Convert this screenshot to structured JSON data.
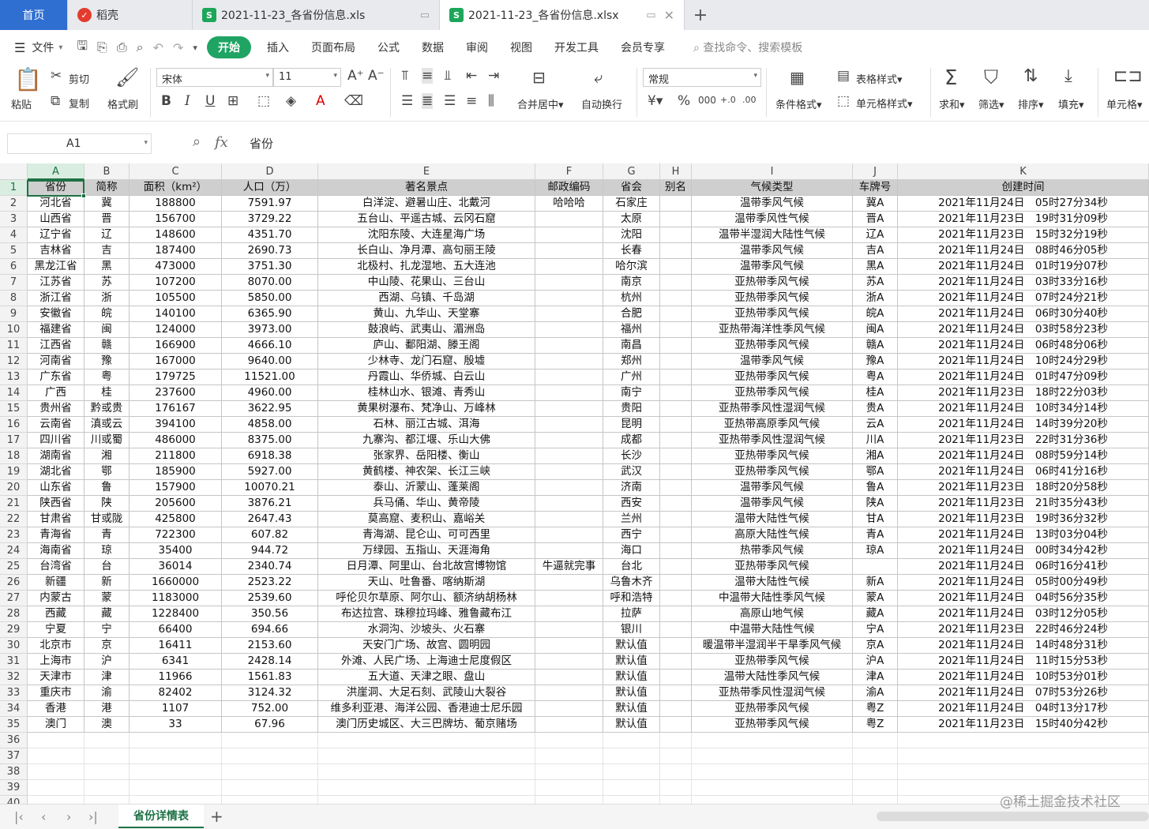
{
  "tabs": {
    "home": "首页",
    "daoke": "稻壳",
    "xls": "2021-11-23_各省份信息.xls",
    "active": "2021-11-23_各省份信息.xlsx",
    "home_color": "#2f6fd1"
  },
  "menu": {
    "file": "文件",
    "items": [
      "开始",
      "插入",
      "页面布局",
      "公式",
      "数据",
      "审阅",
      "视图",
      "开发工具",
      "会员专享"
    ],
    "search": "查找命令、搜索模板",
    "accent": "#1fa463"
  },
  "ribbon": {
    "paste": "粘贴",
    "cut": "剪切",
    "copy": "复制",
    "format_painter": "格式刷",
    "font": "宋体",
    "font_size": "11",
    "merge": "合并居中",
    "wrap": "自动换行",
    "number_format": "常规",
    "cond_format": "条件格式",
    "table_style": "表格样式",
    "cell_style": "单元格样式",
    "sum": "求和",
    "filter": "筛选",
    "sort": "排序",
    "fill": "填充",
    "cell": "单元格"
  },
  "formula_bar": {
    "name_box": "A1",
    "fx": "fx",
    "content": "省份"
  },
  "grid": {
    "columns": [
      "A",
      "B",
      "C",
      "D",
      "E",
      "F",
      "G",
      "H",
      "I",
      "J",
      "K"
    ],
    "header_row": [
      "省份",
      "简称",
      "面积（km²）",
      "人口（万）",
      "著名景点",
      "邮政编码",
      "省会",
      "别名",
      "气候类型",
      "车牌号",
      "创建时间"
    ],
    "rows": [
      [
        "河北省",
        "冀",
        "188800",
        "7591.97",
        "白洋淀、避暑山庄、北戴河",
        "哈哈哈",
        "石家庄",
        "",
        "温带季风气候",
        "冀A",
        "2021年11月24日　05时27分34秒"
      ],
      [
        "山西省",
        "晋",
        "156700",
        "3729.22",
        "五台山、平遥古城、云冈石窟",
        "",
        "太原",
        "",
        "温带季风性气候",
        "晋A",
        "2021年11月23日　19时31分09秒"
      ],
      [
        "辽宁省",
        "辽",
        "148600",
        "4351.70",
        "沈阳东陵、大连星海广场",
        "",
        "沈阳",
        "",
        "温带半湿润大陆性气候",
        "辽A",
        "2021年11月23日　15时32分19秒"
      ],
      [
        "吉林省",
        "吉",
        "187400",
        "2690.73",
        "长白山、净月潭、高句丽王陵",
        "",
        "长春",
        "",
        "温带季风气候",
        "吉A",
        "2021年11月24日　08时46分05秒"
      ],
      [
        "黑龙江省",
        "黑",
        "473000",
        "3751.30",
        "北极村、扎龙湿地、五大连池",
        "",
        "哈尔滨",
        "",
        "温带季风气候",
        "黑A",
        "2021年11月24日　01时19分07秒"
      ],
      [
        "江苏省",
        "苏",
        "107200",
        "8070.00",
        "中山陵、花果山、三台山",
        "",
        "南京",
        "",
        "亚热带季风气候",
        "苏A",
        "2021年11月24日　03时33分16秒"
      ],
      [
        "浙江省",
        "浙",
        "105500",
        "5850.00",
        "西湖、乌镇、千岛湖",
        "",
        "杭州",
        "",
        "亚热带季风气候",
        "浙A",
        "2021年11月24日　07时24分21秒"
      ],
      [
        "安徽省",
        "皖",
        "140100",
        "6365.90",
        "黄山、九华山、天堂寨",
        "",
        "合肥",
        "",
        "亚热带季风气候",
        "皖A",
        "2021年11月24日　06时30分40秒"
      ],
      [
        "福建省",
        "闽",
        "124000",
        "3973.00",
        "鼓浪屿、武夷山、湄洲岛",
        "",
        "福州",
        "",
        "亚热带海洋性季风气候",
        "闽A",
        "2021年11月24日　03时58分23秒"
      ],
      [
        "江西省",
        "赣",
        "166900",
        "4666.10",
        "庐山、鄱阳湖、滕王阁",
        "",
        "南昌",
        "",
        "亚热带季风气候",
        "赣A",
        "2021年11月24日　06时48分06秒"
      ],
      [
        "河南省",
        "豫",
        "167000",
        "9640.00",
        "少林寺、龙门石窟、殷墟",
        "",
        "郑州",
        "",
        "温带季风气候",
        "豫A",
        "2021年11月24日　10时24分29秒"
      ],
      [
        "广东省",
        "粤",
        "179725",
        "11521.00",
        "丹霞山、华侨城、白云山",
        "",
        "广州",
        "",
        "亚热带季风气候",
        "粤A",
        "2021年11月24日　01时47分09秒"
      ],
      [
        "广西",
        "桂",
        "237600",
        "4960.00",
        "桂林山水、银滩、青秀山",
        "",
        "南宁",
        "",
        "亚热带季风气候",
        "桂A",
        "2021年11月23日　18时22分03秒"
      ],
      [
        "贵州省",
        "黔或贵",
        "176167",
        "3622.95",
        "黄果树瀑布、梵净山、万峰林",
        "",
        "贵阳",
        "",
        "亚热带季风性湿润气候",
        "贵A",
        "2021年11月24日　10时34分14秒"
      ],
      [
        "云南省",
        "滇或云",
        "394100",
        "4858.00",
        "石林、丽江古城、洱海",
        "",
        "昆明",
        "",
        "亚热带高原季风气候",
        "云A",
        "2021年11月24日　14时39分20秒"
      ],
      [
        "四川省",
        "川或蜀",
        "486000",
        "8375.00",
        "九寨沟、都江堰、乐山大佛",
        "",
        "成都",
        "",
        "亚热带季风性湿润气候",
        "川A",
        "2021年11月23日　22时31分36秒"
      ],
      [
        "湖南省",
        "湘",
        "211800",
        "6918.38",
        "张家界、岳阳楼、衡山",
        "",
        "长沙",
        "",
        "亚热带季风气候",
        "湘A",
        "2021年11月24日　08时59分14秒"
      ],
      [
        "湖北省",
        "鄂",
        "185900",
        "5927.00",
        "黄鹤楼、神农架、长江三峡",
        "",
        "武汉",
        "",
        "亚热带季风气候",
        "鄂A",
        "2021年11月24日　06时41分16秒"
      ],
      [
        "山东省",
        "鲁",
        "157900",
        "10070.21",
        "泰山、沂蒙山、蓬莱阁",
        "",
        "济南",
        "",
        "温带季风气候",
        "鲁A",
        "2021年11月23日　18时20分58秒"
      ],
      [
        "陕西省",
        "陕",
        "205600",
        "3876.21",
        "兵马俑、华山、黄帝陵",
        "",
        "西安",
        "",
        "温带季风气候",
        "陕A",
        "2021年11月23日　21时35分43秒"
      ],
      [
        "甘肃省",
        "甘或陇",
        "425800",
        "2647.43",
        "莫高窟、麦积山、嘉峪关",
        "",
        "兰州",
        "",
        "温带大陆性气候",
        "甘A",
        "2021年11月23日　19时36分32秒"
      ],
      [
        "青海省",
        "青",
        "722300",
        "607.82",
        "青海湖、昆仑山、可可西里",
        "",
        "西宁",
        "",
        "高原大陆性气候",
        "青A",
        "2021年11月24日　13时03分04秒"
      ],
      [
        "海南省",
        "琼",
        "35400",
        "944.72",
        "万绿园、五指山、天涯海角",
        "",
        "海口",
        "",
        "热带季风气候",
        "琼A",
        "2021年11月24日　00时34分42秒"
      ],
      [
        "台湾省",
        "台",
        "36014",
        "2340.74",
        "日月潭、阿里山、台北故宫博物馆",
        "牛逼就完事",
        "台北",
        "",
        "亚热带季风气候",
        "",
        "2021年11月24日　06时16分41秒"
      ],
      [
        "新疆",
        "新",
        "1660000",
        "2523.22",
        "天山、吐鲁番、喀纳斯湖",
        "",
        "乌鲁木齐",
        "",
        "温带大陆性气候",
        "新A",
        "2021年11月24日　05时00分49秒"
      ],
      [
        "内蒙古",
        "蒙",
        "1183000",
        "2539.60",
        "呼伦贝尔草原、阿尔山、额济纳胡杨林",
        "",
        "呼和浩特",
        "",
        "中温带大陆性季风气候",
        "蒙A",
        "2021年11月24日　04时56分35秒"
      ],
      [
        "西藏",
        "藏",
        "1228400",
        "350.56",
        "布达拉宫、珠穆拉玛峰、雅鲁藏布江",
        "",
        "拉萨",
        "",
        "高原山地气候",
        "藏A",
        "2021年11月24日　03时12分05秒"
      ],
      [
        "宁夏",
        "宁",
        "66400",
        "694.66",
        "水洞沟、沙坡头、火石寨",
        "",
        "银川",
        "",
        "中温带大陆性气候",
        "宁A",
        "2021年11月23日　22时46分24秒"
      ],
      [
        "北京市",
        "京",
        "16411",
        "2153.60",
        "天安门广场、故宫、圆明园",
        "",
        "默认值",
        "",
        "暖温带半湿润半干旱季风气候",
        "京A",
        "2021年11月24日　14时48分31秒"
      ],
      [
        "上海市",
        "沪",
        "6341",
        "2428.14",
        "外滩、人民广场、上海迪士尼度假区",
        "",
        "默认值",
        "",
        "亚热带季风气候",
        "沪A",
        "2021年11月24日　11时15分53秒"
      ],
      [
        "天津市",
        "津",
        "11966",
        "1561.83",
        "五大道、天津之眼、盘山",
        "",
        "默认值",
        "",
        "温带大陆性季风气候",
        "津A",
        "2021年11月24日　10时53分01秒"
      ],
      [
        "重庆市",
        "渝",
        "82402",
        "3124.32",
        "洪崖洞、大足石刻、武陵山大裂谷",
        "",
        "默认值",
        "",
        "亚热带季风性湿润气候",
        "渝A",
        "2021年11月24日　07时53分26秒"
      ],
      [
        "香港",
        "港",
        "1107",
        "752.00",
        "维多利亚港、海洋公园、香港迪士尼乐园",
        "",
        "默认值",
        "",
        "亚热带季风气候",
        "粤Z",
        "2021年11月24日　04时13分17秒"
      ],
      [
        "澳门",
        "澳",
        "33",
        "67.96",
        "澳门历史城区、大三巴牌坊、葡京赌场",
        "",
        "默认值",
        "",
        "亚热带季风气候",
        "粤Z",
        "2021年11月23日　15时40分42秒"
      ]
    ],
    "row_numbers": [
      "1",
      "2",
      "3",
      "4",
      "5",
      "6",
      "7",
      "8",
      "9",
      "10",
      "11",
      "12",
      "13",
      "14",
      "15",
      "16",
      "17",
      "18",
      "19",
      "20",
      "21",
      "22",
      "23",
      "24",
      "25",
      "26",
      "27",
      "28",
      "29",
      "30",
      "31",
      "32",
      "33",
      "34",
      "35",
      "36",
      "37",
      "38",
      "39",
      "40"
    ],
    "selection_color": "#1e7145"
  },
  "sheets": {
    "active": "省份详情表",
    "add": "+"
  },
  "watermark": "@稀土掘金技术社区"
}
